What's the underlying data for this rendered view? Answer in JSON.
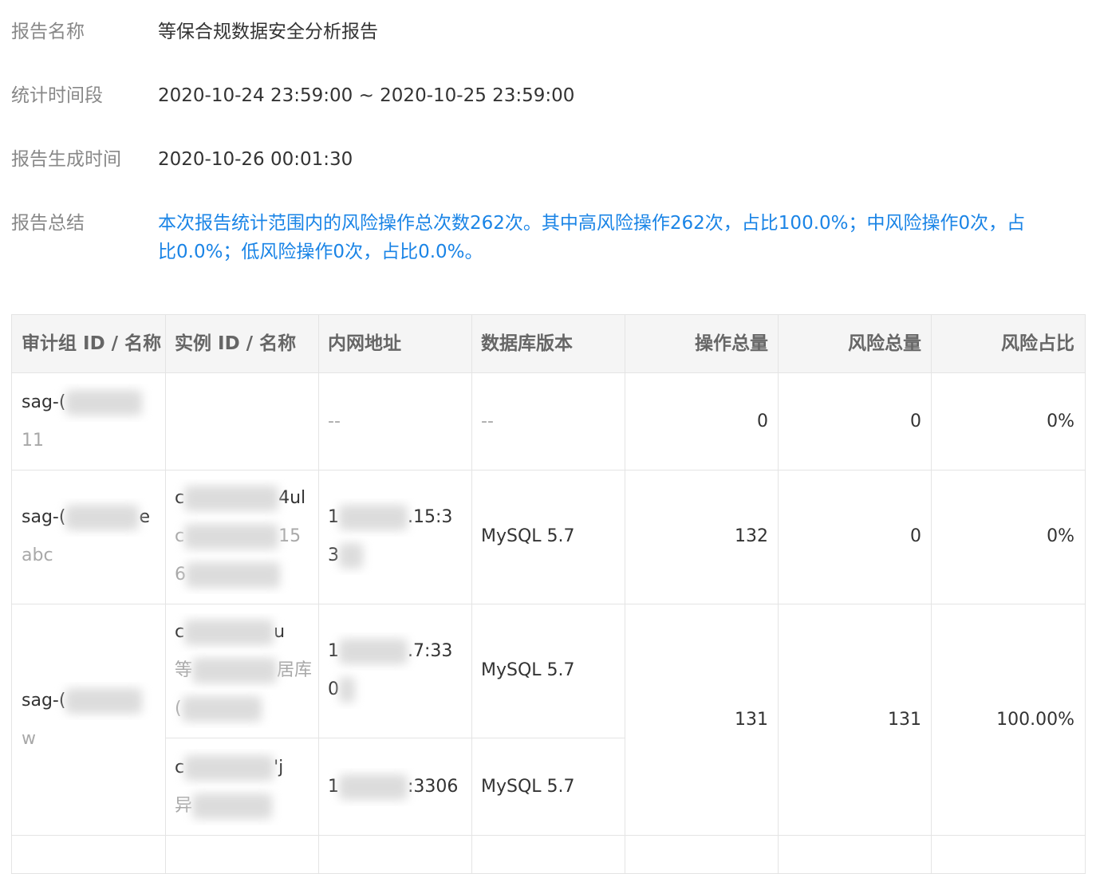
{
  "info": {
    "report_name_label": "报告名称",
    "report_name": "等保合规数据安全分析报告",
    "period_label": "统计时间段",
    "period": "2020-10-24 23:59:00 ~ 2020-10-25 23:59:00",
    "generated_label": "报告生成时间",
    "generated": "2020-10-26 00:01:30",
    "summary_label": "报告总结",
    "summary": "本次报告统计范围内的风险操作总次数262次。其中高风险操作262次，占比100.0%；中风险操作0次，占比0.0%；低风险操作0次，占比0.0%。"
  },
  "table": {
    "headers": [
      "审计组 ID / 名称",
      "实例 ID / 名称",
      "内网地址",
      "数据库版本",
      "操作总量",
      "风险总量",
      "风险占比"
    ],
    "rows": [
      {
        "group_id": "sag-(",
        "group_name": "11",
        "address": "--",
        "version": "--",
        "ops": "0",
        "risk": "0",
        "ratio": "0%"
      },
      {
        "group_id": "sag-(",
        "group_id_tail": "e",
        "group_name": "abc",
        "inst_id_head": "c",
        "inst_id_tail": "4ul",
        "inst_name_head": "c",
        "inst_name_tail": "15",
        "inst_name_line3": "6",
        "addr_head": "1",
        "addr_tail": ".15:3",
        "addr_line2": "3",
        "version": "MySQL 5.7",
        "ops": "132",
        "risk": "0",
        "ratio": "0%"
      },
      {
        "group_id": "sag-(",
        "group_name": "w",
        "ops": "131",
        "risk": "131",
        "ratio": "100.00%",
        "instances": [
          {
            "id_head": "c",
            "id_tail": "u",
            "name_head": "等",
            "name_tail": "居库",
            "name_line3": "(",
            "addr_head": "1",
            "addr_tail": ".7:33",
            "addr_line2": "0",
            "version": "MySQL 5.7"
          },
          {
            "id_head": "c",
            "id_tail": "'j",
            "name_head": "异",
            "addr_head": "1",
            "addr_tail": ":3306",
            "version": "MySQL 5.7"
          }
        ]
      }
    ]
  }
}
